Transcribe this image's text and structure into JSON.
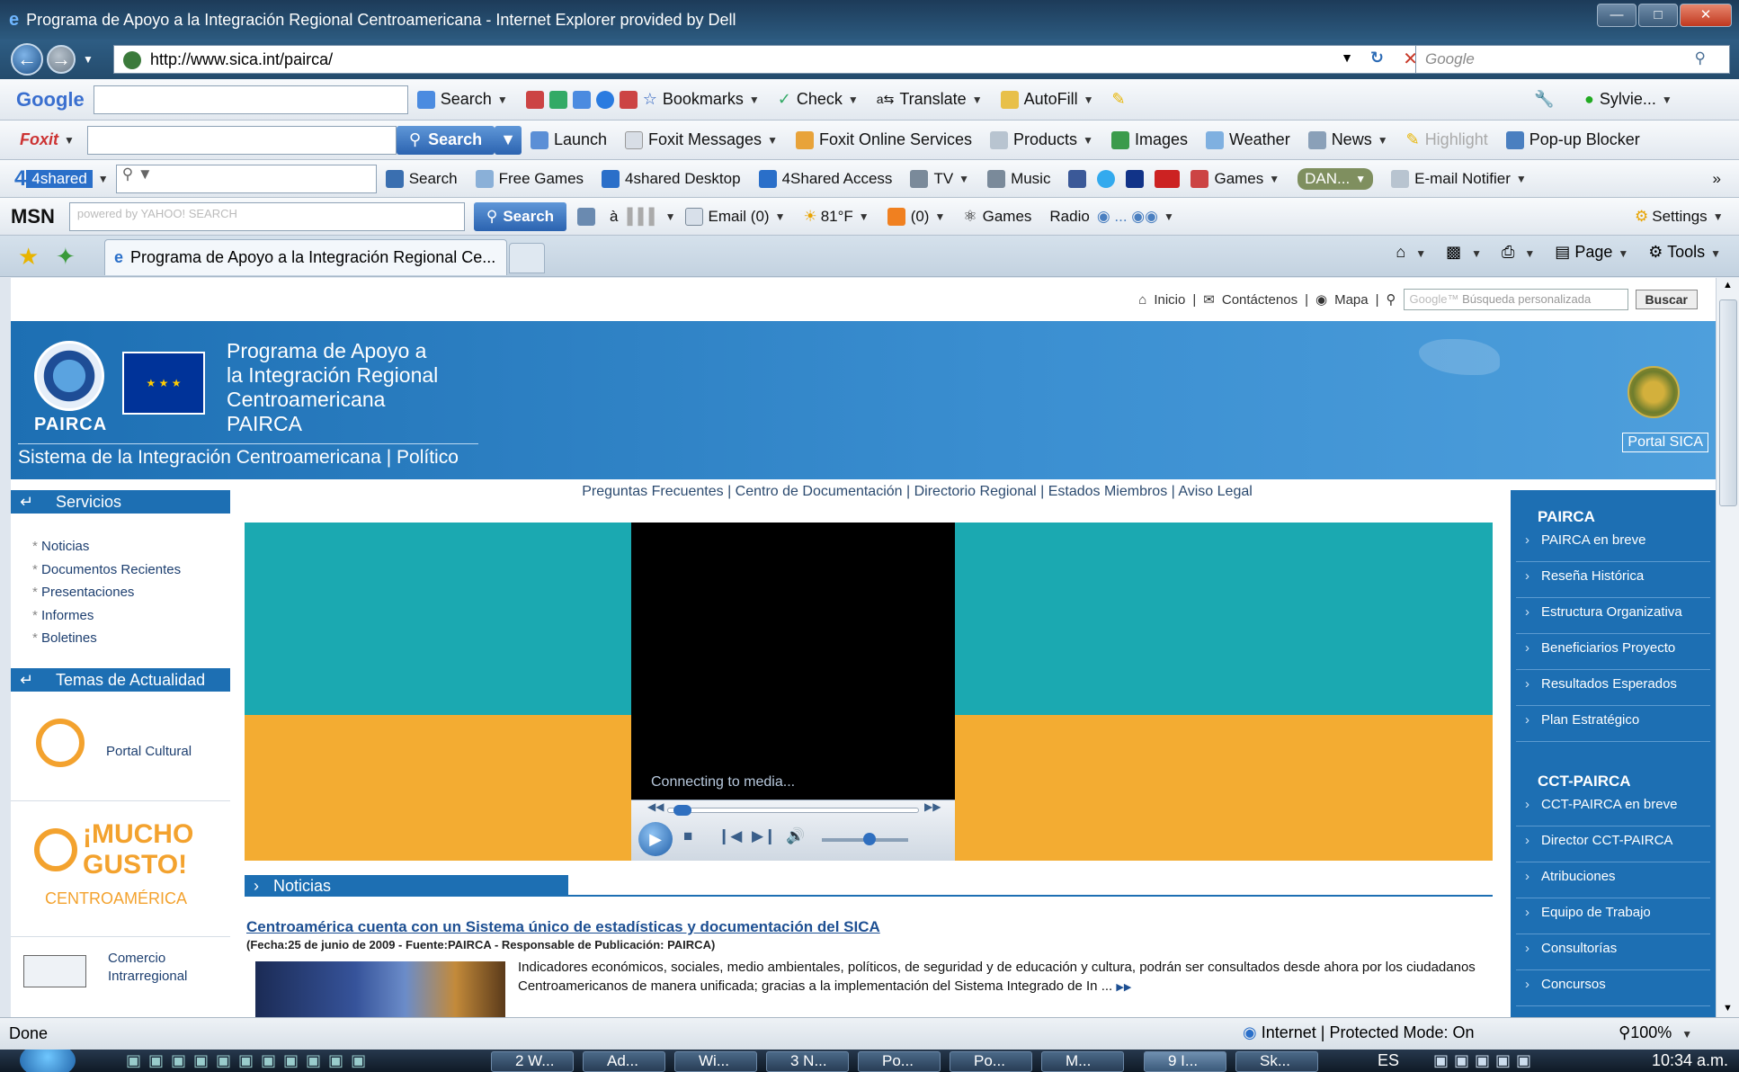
{
  "window": {
    "title": "Programa de Apoyo a la Integración Regional Centroamericana - Internet Explorer provided by Dell"
  },
  "address": {
    "url": "http://www.sica.int/pairca/",
    "search_placeholder": "Google"
  },
  "google_toolbar": {
    "brand": "Google",
    "items": [
      "Search",
      "Bookmarks",
      "Check",
      "Translate",
      "AutoFill"
    ],
    "user": "Sylvie..."
  },
  "foxit_toolbar": {
    "brand": "Foxit",
    "search_label": "Search",
    "items": [
      "Launch",
      "Foxit Messages",
      "Foxit Online Services",
      "Products",
      "Images",
      "Weather",
      "News",
      "Highlight",
      "Pop-up Blocker"
    ]
  },
  "shared_toolbar": {
    "brand": "4shared",
    "items": [
      "Search",
      "Free Games",
      "4shared Desktop",
      "4Shared Access",
      "TV",
      "Music",
      "Games",
      "DAN...",
      "E-mail Notifier"
    ]
  },
  "msn_toolbar": {
    "brand": "MSN",
    "yahoo_label": "powered by YAHOO! SEARCH",
    "search_label": "Search",
    "email": "Email (0)",
    "weather": "81°F",
    "rss": "(0)",
    "games": "Games",
    "radio": "Radio",
    "settings": "Settings"
  },
  "tab": {
    "label": "Programa de Apoyo a la Integración Regional Ce...",
    "commands": [
      "Page",
      "Tools"
    ]
  },
  "site": {
    "topnav": [
      "Inicio",
      "Contáctenos",
      "Mapa"
    ],
    "search_placeholder": "Búsqueda personalizada",
    "search_button": "Buscar",
    "logo_text": "PAIRCA",
    "title_lines": [
      "Programa de Apoyo a",
      "la Integración Regional",
      "Centroamericana",
      "PAIRCA"
    ],
    "subtitle": "Sistema de la Integración Centroamericana | Político",
    "portal_sica": "Portal SICA",
    "links": "Preguntas Frecuentes | Centro de Documentación | Directorio Regional | Estados Miembros | Aviso Legal"
  },
  "left": {
    "servicios_title": "Servicios",
    "servicios": [
      "Noticias",
      "Documentos Recientes",
      "Presentaciones",
      "Informes",
      "Boletines"
    ],
    "temas_title": "Temas de Actualidad",
    "portal_cultural": "Portal Cultural",
    "mucho_gusto": "¡MUCHO GUSTO!",
    "centroamerica": "CENTROAMÉRICA",
    "comercio": "Comercio Intrarregional"
  },
  "video": {
    "status": "Connecting to media..."
  },
  "news": {
    "section_title": "Noticias",
    "headline": "Centroamérica cuenta con un Sistema único de estadísticas y documentación del SICA",
    "dateline": "(Fecha:25 de junio de 2009 - Fuente:PAIRCA - Responsable de Publicación: PAIRCA)",
    "summary": "Indicadores económicos, sociales, medio ambientales, políticos, de seguridad y de educación y cultura, podrán ser consultados desde ahora por los ciudadanos Centroamericanos de manera unificada; gracias a la implementación del Sistema Integrado de In ..."
  },
  "right": {
    "pairca_title": "PAIRCA",
    "pairca_items": [
      "PAIRCA en breve",
      "Reseña Histórica",
      "Estructura Organizativa",
      "Beneficiarios Proyecto",
      "Resultados Esperados",
      "Plan Estratégico"
    ],
    "cct_title": "CCT-PAIRCA",
    "cct_items": [
      "CCT-PAIRCA en breve",
      "Director CCT-PAIRCA",
      "Atribuciones",
      "Equipo de Trabajo",
      "Consultorías",
      "Concursos"
    ]
  },
  "statusbar": {
    "left": "Done",
    "zone": "Internet | Protected Mode: On",
    "zoom": "100%"
  },
  "taskbar": {
    "tasks": [
      "2 W...",
      "Ad...",
      "Wi...",
      "3 N...",
      "Po...",
      "Po...",
      "M...",
      "9 I...",
      "Sk..."
    ],
    "lang": "ES",
    "clock": "10:34 a.m."
  }
}
